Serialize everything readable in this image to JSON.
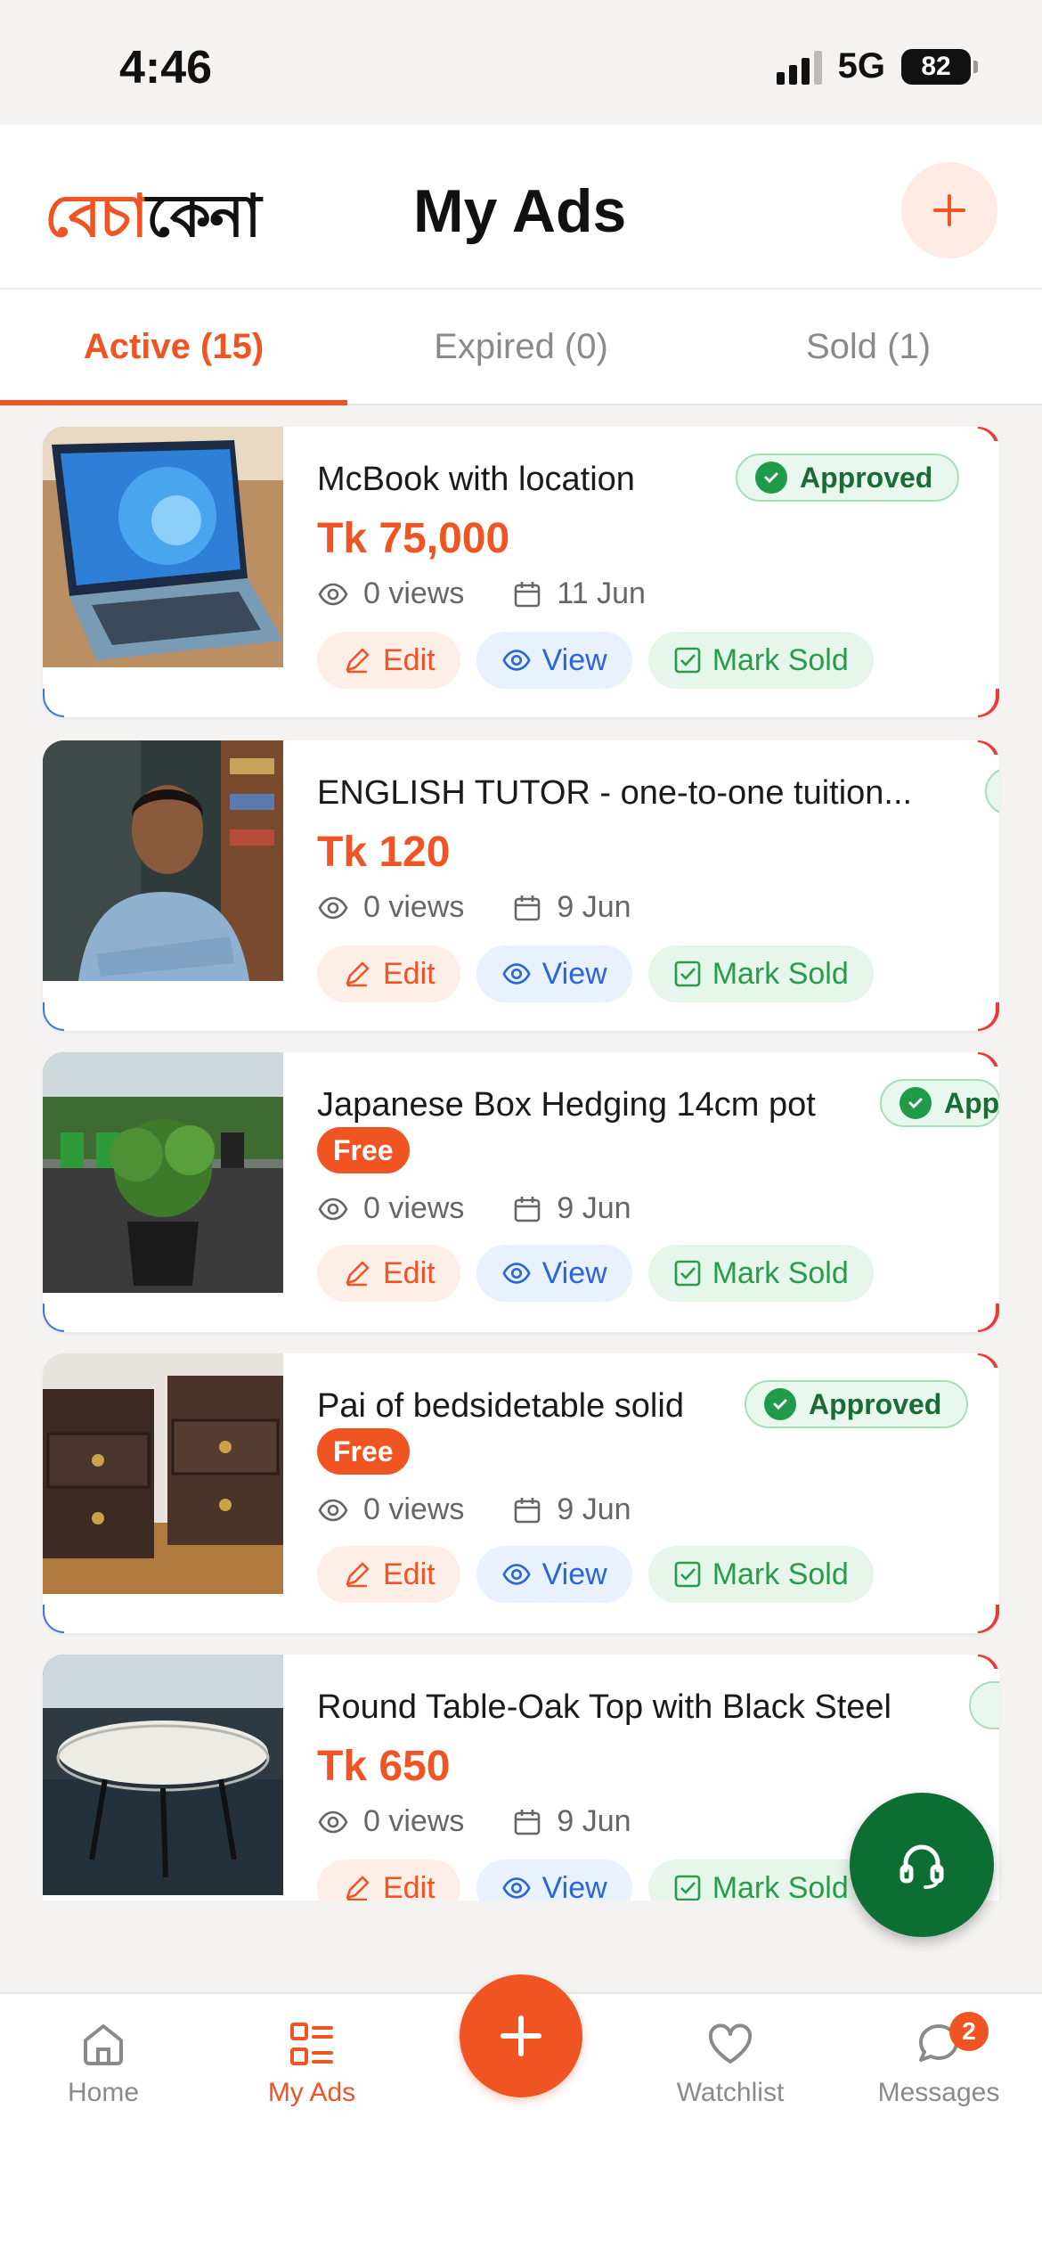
{
  "status_bar": {
    "time": "4:46",
    "network": "5G",
    "battery": "82"
  },
  "header": {
    "logo_part1": "বেচা",
    "logo_part2": "কেনা",
    "title": "My Ads"
  },
  "tabs": [
    {
      "label": "Active (15)",
      "active": true
    },
    {
      "label": "Expired (0)",
      "active": false
    },
    {
      "label": "Sold (1)",
      "active": false
    }
  ],
  "ads": [
    {
      "title": "McBook with location",
      "price": "Tk 75,000",
      "free": "",
      "status": "Approved",
      "views": "0 views",
      "date": "11 Jun",
      "thumb": "laptop"
    },
    {
      "title": "ENGLISH TUTOR - one-to-one tuition...",
      "price": "Tk 120",
      "free": "",
      "status": "",
      "views": "0 views",
      "date": "9 Jun",
      "thumb": "person"
    },
    {
      "title": "Japanese Box Hedging 14cm pot",
      "price": "",
      "free": "Free",
      "status": "App",
      "views": "0 views",
      "date": "9 Jun",
      "thumb": "plant"
    },
    {
      "title": "Pai of bedsidetable solid",
      "price": "",
      "free": "Free",
      "status": "Approved",
      "views": "0 views",
      "date": "9 Jun",
      "thumb": "furniture"
    },
    {
      "title": "Round Table-Oak Top with Black Steel",
      "price": "Tk 650",
      "free": "",
      "status": "",
      "views": "0 views",
      "date": "9 Jun",
      "thumb": "table"
    }
  ],
  "actions": {
    "edit": "Edit",
    "view": "View",
    "mark_sold": "Mark Sold"
  },
  "bottom_nav": {
    "home": "Home",
    "my_ads": "My Ads",
    "watchlist": "Watchlist",
    "messages": "Messages",
    "messages_badge": "2"
  },
  "colors": {
    "accent": "#f05423",
    "approved": "#1f9a48",
    "view_blue": "#2b66d6",
    "support_green": "#0c6e33"
  }
}
